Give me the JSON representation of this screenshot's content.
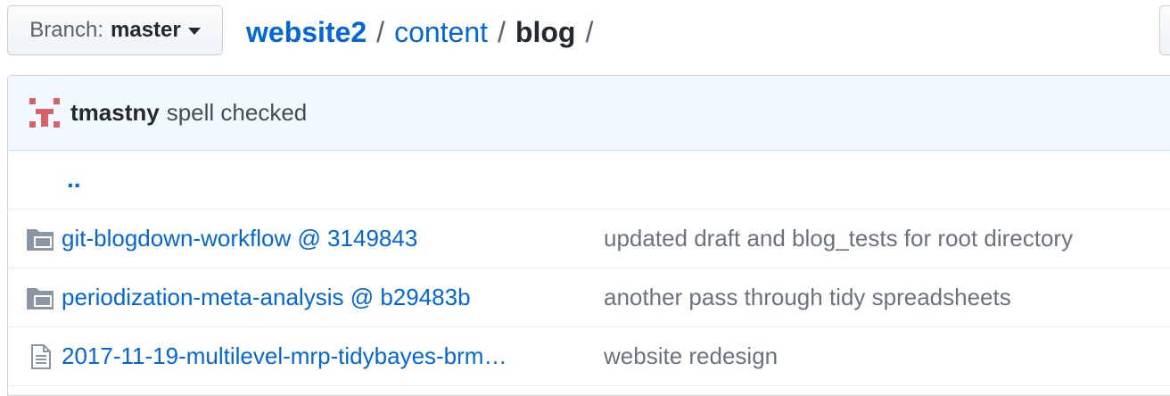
{
  "branch": {
    "label": "Branch:",
    "value": "master"
  },
  "breadcrumb": {
    "repo": "website2",
    "sep1": "/",
    "folder": "content",
    "sep2": "/",
    "current": "blog",
    "sep3": "/"
  },
  "latest_commit": {
    "author": "tmastny",
    "message": "spell checked"
  },
  "parent_dir": "..",
  "files": [
    {
      "type": "submodule",
      "icon": "submodule-folder-icon",
      "name": "git-blogdown-workflow @ 3149843",
      "commit": "updated draft and blog_tests for root directory"
    },
    {
      "type": "submodule",
      "icon": "submodule-folder-icon",
      "name": "periodization-meta-analysis @ b29483b",
      "commit": "another pass through tidy spreadsheets"
    },
    {
      "type": "file",
      "icon": "file-icon",
      "name": "2017-11-19-multilevel-mrp-tidybayes-brm…",
      "commit": "website redesign"
    }
  ],
  "colors": {
    "link": "#0366d6",
    "commit_bar_bg": "#f1f8ff",
    "avatar": "#d7616b"
  }
}
